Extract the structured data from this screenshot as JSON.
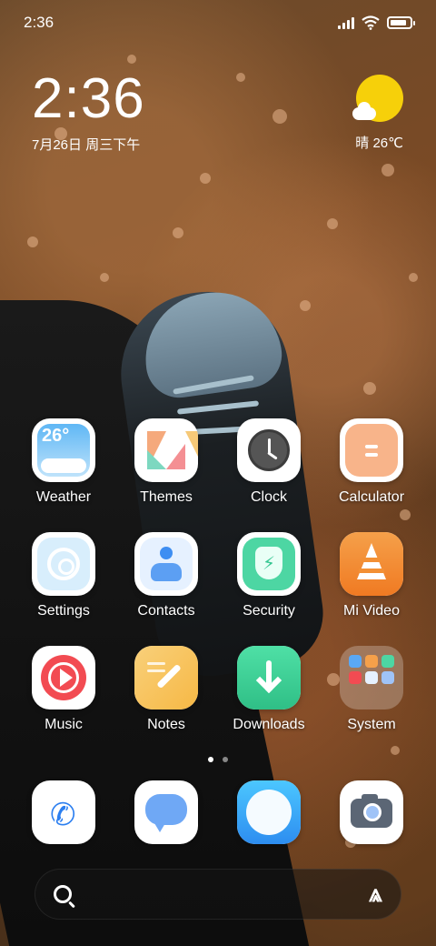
{
  "status_bar": {
    "time": "2:36",
    "icons": [
      "signal-icon",
      "wifi-icon",
      "battery-icon"
    ],
    "battery_level": 0.85
  },
  "clock_widget": {
    "time": "2:36",
    "date": "7月26日 周三下午"
  },
  "weather_widget": {
    "icon": "sunny-partly-cloudy-icon",
    "text": "晴 26℃"
  },
  "apps": [
    {
      "label": "Weather",
      "icon": "weather-icon",
      "badge_text": "26°"
    },
    {
      "label": "Themes",
      "icon": "themes-icon"
    },
    {
      "label": "Clock",
      "icon": "clock-icon"
    },
    {
      "label": "Calculator",
      "icon": "calculator-icon"
    },
    {
      "label": "Settings",
      "icon": "settings-icon"
    },
    {
      "label": "Contacts",
      "icon": "contacts-icon"
    },
    {
      "label": "Security",
      "icon": "security-icon"
    },
    {
      "label": "Mi Video",
      "icon": "mi-video-icon"
    },
    {
      "label": "Music",
      "icon": "music-icon"
    },
    {
      "label": "Notes",
      "icon": "notes-icon"
    },
    {
      "label": "Downloads",
      "icon": "downloads-icon"
    },
    {
      "label": "System",
      "icon": "system-folder-icon"
    }
  ],
  "page_indicator": {
    "pages": 2,
    "active": 0
  },
  "dock": [
    {
      "icon": "phone-icon"
    },
    {
      "icon": "messages-icon"
    },
    {
      "icon": "browser-icon"
    },
    {
      "icon": "camera-icon"
    }
  ],
  "search_bar": {
    "left_icon": "search-icon",
    "right_icon": "assistant-icon"
  },
  "colors": {
    "weather_accent": "#5fb7f5",
    "security_accent": "#4dd6a3",
    "video_accent": "#f07a22",
    "music_accent": "#f24b52",
    "sun": "#f6d00a"
  }
}
